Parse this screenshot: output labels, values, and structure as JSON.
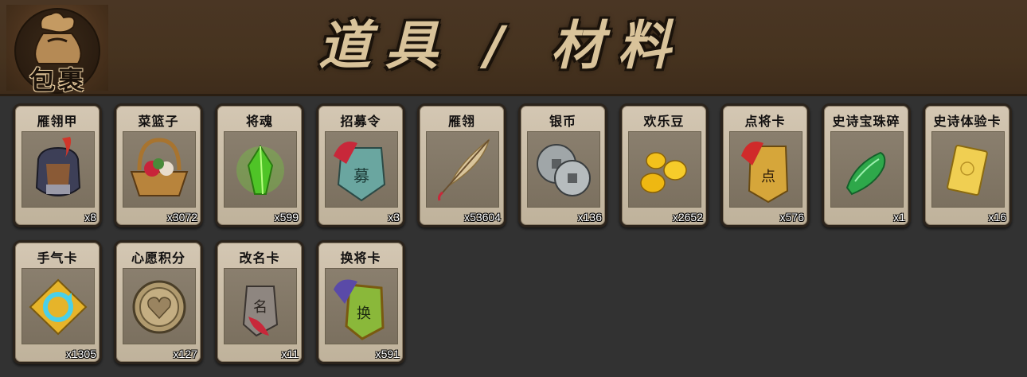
{
  "header": {
    "badge_label": "包裹",
    "title": "道具 / 材料"
  },
  "items": [
    {
      "name": "雁翎甲",
      "count": "x8",
      "icon": "armor-icon"
    },
    {
      "name": "菜篮子",
      "count": "x3072",
      "icon": "basket-icon"
    },
    {
      "name": "将魂",
      "count": "x599",
      "icon": "green-crystal-icon"
    },
    {
      "name": "招募令",
      "count": "x3",
      "icon": "recruit-token-icon"
    },
    {
      "name": "雁翎",
      "count": "x53604",
      "icon": "feather-icon"
    },
    {
      "name": "银币",
      "count": "x136",
      "icon": "silver-coin-icon"
    },
    {
      "name": "欢乐豆",
      "count": "x2652",
      "icon": "gold-beans-icon"
    },
    {
      "name": "点将卡",
      "count": "x576",
      "icon": "general-card-icon"
    },
    {
      "name": "史诗宝珠碎",
      "count": "x1",
      "icon": "jade-shard-icon"
    },
    {
      "name": "史诗体验卡",
      "count": "x16",
      "icon": "gold-card-icon"
    },
    {
      "name": "手气卡",
      "count": "x1305",
      "icon": "luck-card-icon"
    },
    {
      "name": "心愿积分",
      "count": "x127",
      "icon": "heart-coin-icon"
    },
    {
      "name": "改名卡",
      "count": "x11",
      "icon": "rename-card-icon"
    },
    {
      "name": "换将卡",
      "count": "x591",
      "icon": "swap-general-icon"
    }
  ]
}
